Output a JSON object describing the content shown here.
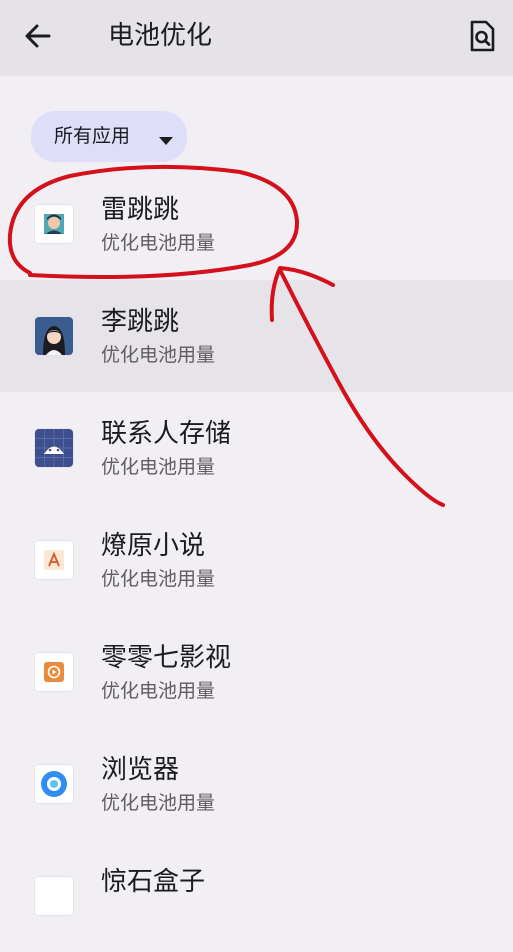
{
  "header": {
    "title": "电池优化",
    "back_icon": "arrow-left-icon",
    "search_icon": "document-search-icon"
  },
  "filter": {
    "label": "所有应用",
    "icon": "chevron-down-icon"
  },
  "apps": [
    {
      "name": "雷跳跳",
      "status": "优化电池用量",
      "icon": "avatar-man-icon"
    },
    {
      "name": "李跳跳",
      "status": "优化电池用量",
      "icon": "avatar-girl-icon"
    },
    {
      "name": "联系人存储",
      "status": "优化电池用量",
      "icon": "android-icon"
    },
    {
      "name": "燎原小说",
      "status": "优化电池用量",
      "icon": "book-flame-icon"
    },
    {
      "name": "零零七影视",
      "status": "优化电池用量",
      "icon": "video-icon"
    },
    {
      "name": "浏览器",
      "status": "优化电池用量",
      "icon": "browser-icon"
    },
    {
      "name": "惊石盒子",
      "status": "",
      "icon": "app-icon"
    }
  ],
  "colors": {
    "background": "#f1eff4",
    "topbar": "#e5e3e6",
    "chip": "#dfdef8",
    "highlight_row": "#e6e4e9",
    "annotation": "#d4101a"
  }
}
